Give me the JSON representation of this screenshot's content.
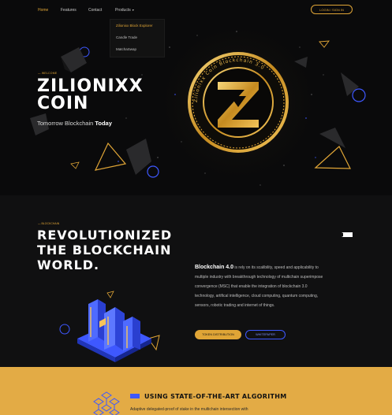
{
  "nav": {
    "items": [
      {
        "label": "Home",
        "active": true
      },
      {
        "label": "Features",
        "active": false
      },
      {
        "label": "Contact",
        "active": false
      },
      {
        "label": "Products",
        "active": false
      }
    ],
    "login_label": "LOGIN / SIGN IN",
    "dropdown": [
      {
        "label": "Zilionixx Block Explorer",
        "active": true
      },
      {
        "label": "Candle Trade",
        "active": false
      },
      {
        "label": "MatchaSwap",
        "active": false
      }
    ]
  },
  "hero": {
    "kicker": "— WELCOME",
    "title_line1": "ZILIONIXX",
    "title_line2": "COIN",
    "subtitle_prefix": "Tomorrow Blockchain ",
    "subtitle_bold": "Today",
    "coin_text": "Zilionixx Coin Blockchain 3.0"
  },
  "section2": {
    "kicker": "— BLOCKCHAIN",
    "title_line1": "REVOLUTIONIZED",
    "title_line2": "THE BLOCKCHAIN",
    "title_line3": "WORLD.",
    "body_bold": "Blockchain 4.0",
    "body_text": " is rely on its scalibility, speed and applicability to multiple industry with breakthrough technology of multichain superimpose convergence (MSC) that enable the integration of blockchain 3.0 technology, artifical intelligence, cloud computing, quantum computing, sensors, robotic trading and internet of things.",
    "token_button": "TOKEN DISTRIBUTION",
    "whitepaper_button": "WHITEPAPER"
  },
  "section3": {
    "title": "USING STATE-OF-THE-ART ALGORITHM",
    "text": "Adaptive delegated-proof of stake in the multichain intersection with"
  },
  "colors": {
    "accent": "#e0a536",
    "blue": "#3e58ff",
    "background": "#0b0b0c"
  }
}
